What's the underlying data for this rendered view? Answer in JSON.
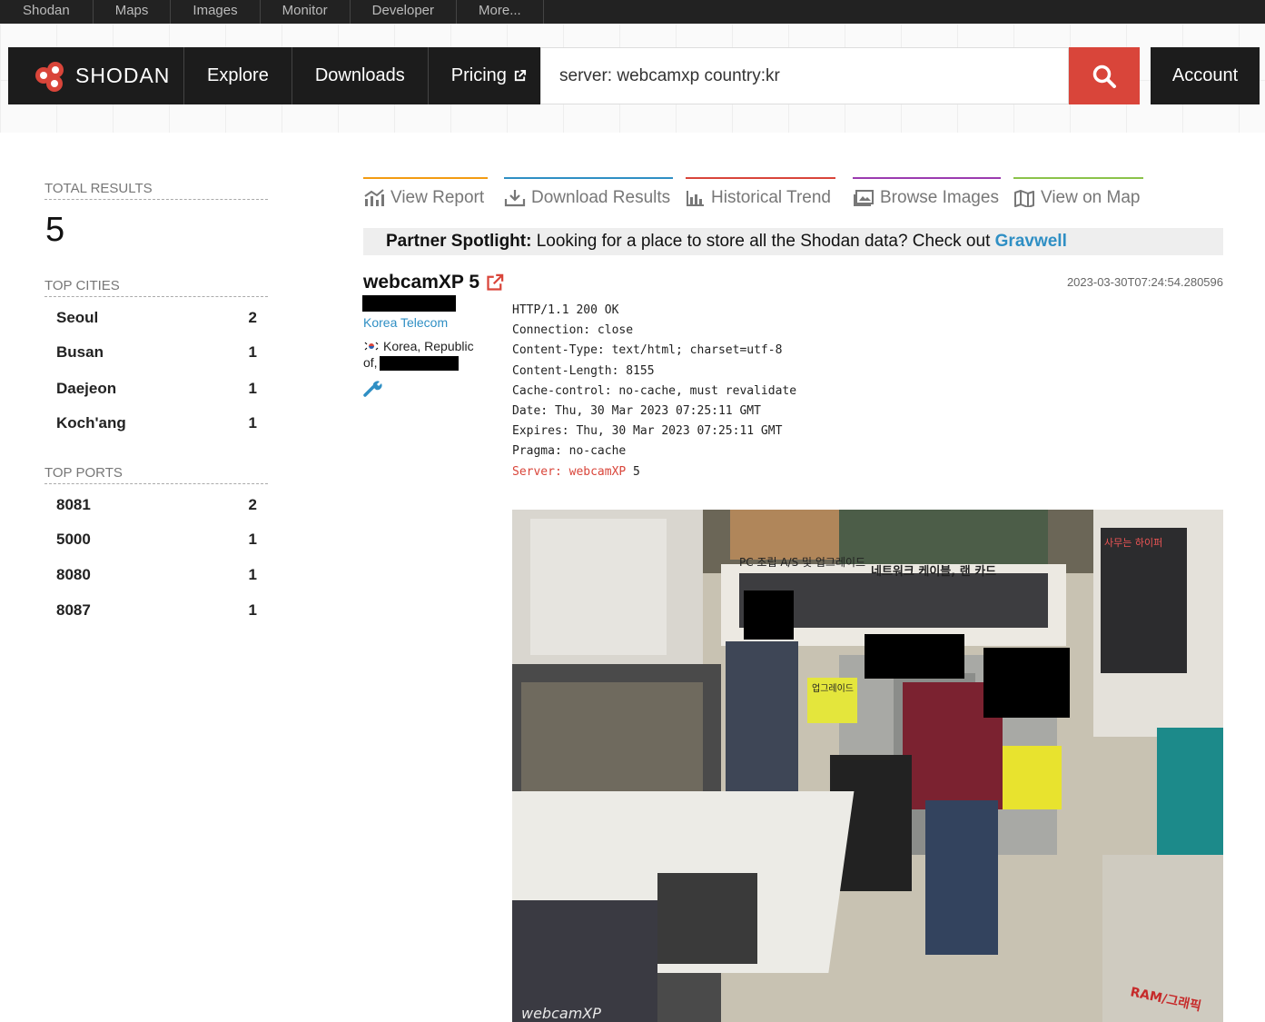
{
  "topbar": {
    "links": [
      "Shodan",
      "Maps",
      "Images",
      "Monitor",
      "Developer",
      "More..."
    ]
  },
  "header": {
    "logo_text": "SHODAN",
    "nav": [
      "Explore",
      "Downloads",
      "Pricing"
    ],
    "search_value": "server: webcamxp country:kr",
    "account_label": "Account",
    "icons": [
      "shodan-logo",
      "external-link-icon",
      "search-icon"
    ]
  },
  "sidebar": {
    "total_label": "TOTAL RESULTS",
    "total_value": "5",
    "cities_label": "TOP CITIES",
    "cities": [
      {
        "name": "Seoul",
        "count": "2"
      },
      {
        "name": "Busan",
        "count": "1"
      },
      {
        "name": "Daejeon",
        "count": "1"
      },
      {
        "name": "Koch'ang",
        "count": "1"
      }
    ],
    "ports_label": "TOP PORTS",
    "ports": [
      {
        "name": "8081",
        "count": "2"
      },
      {
        "name": "5000",
        "count": "1"
      },
      {
        "name": "8080",
        "count": "1"
      },
      {
        "name": "8087",
        "count": "1"
      }
    ]
  },
  "tabs": [
    {
      "label": "View Report",
      "color": "#f39c12",
      "icon": "report-icon"
    },
    {
      "label": "Download Results",
      "color": "#2f8fc4",
      "icon": "download-icon"
    },
    {
      "label": "Historical Trend",
      "color": "#d9453a",
      "icon": "trend-icon"
    },
    {
      "label": "Browse Images",
      "color": "#9b3bb0",
      "icon": "images-icon"
    },
    {
      "label": "View on Map",
      "color": "#8bc34a",
      "icon": "map-icon"
    }
  ],
  "spotlight": {
    "label": "Partner Spotlight:",
    "text": "Looking for a place to store all the Shodan data? Check out",
    "link": "Gravwell"
  },
  "result": {
    "title": "webcamXP 5",
    "timestamp": "2023-03-30T07:24:54.280596",
    "isp": "Korea Telecom",
    "country": "Korea, Republic of,",
    "banner": [
      "HTTP/1.1 200 OK",
      "Connection: close",
      "Content-Type: text/html; charset=utf-8",
      "Content-Length: 8155",
      "Cache-control: no-cache, must revalidate",
      "Date: Thu, 30 Mar 2023 07:25:11 GMT",
      "Expires: Thu, 30 Mar 2023 07:25:11 GMT",
      "Pragma: no-cache"
    ],
    "server_key": "Server: webcamXP",
    "server_version": " 5",
    "cam_sign_1": "PC 조립 A/S 및 업그레이드",
    "cam_sign_2": "네트워크 케이블, 랜 카드",
    "cam_sign_3": "RAM/그래픽",
    "cam_sign_4": "사무는 하이퍼",
    "cam_sign_5": "업그레이드",
    "cam_watermark": "webcamXP"
  }
}
